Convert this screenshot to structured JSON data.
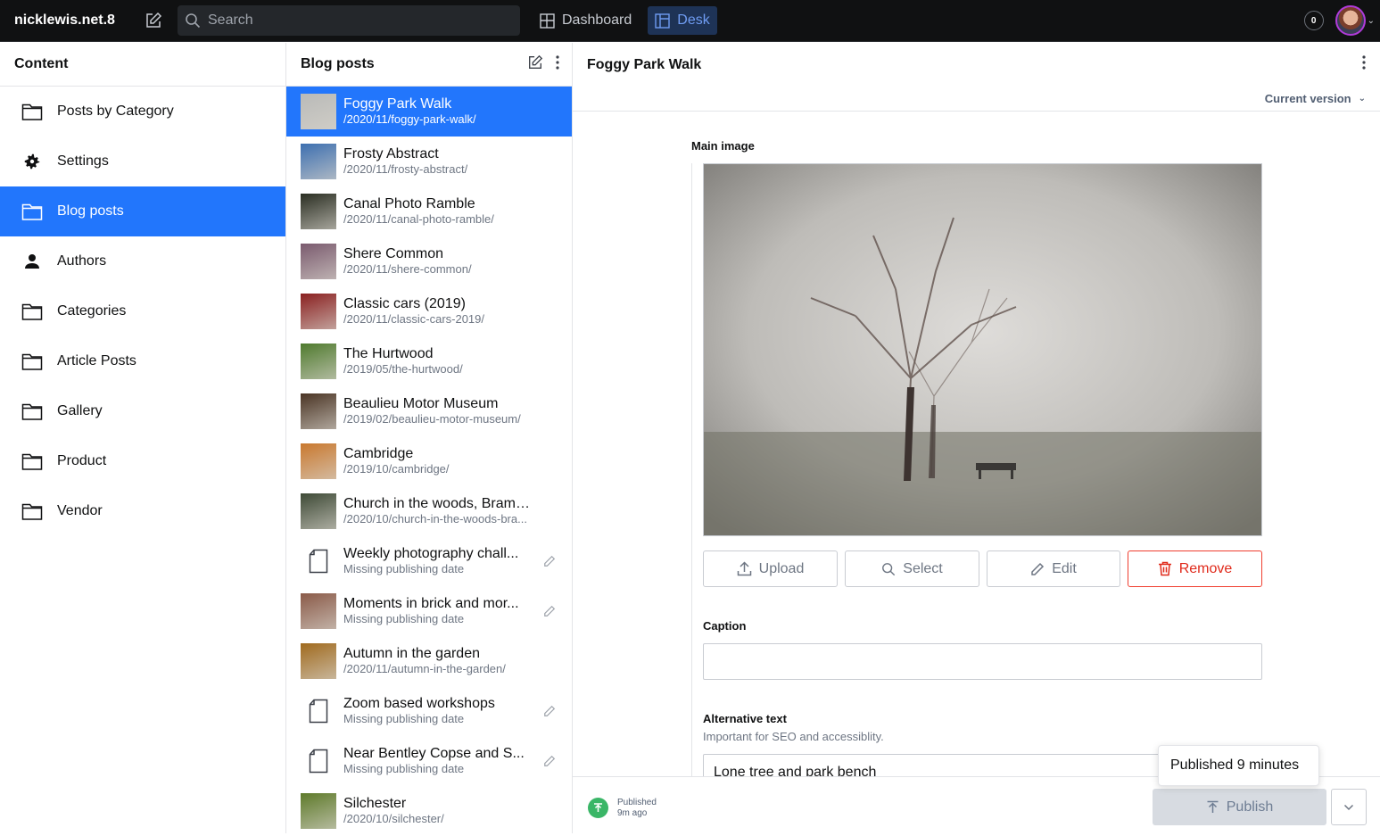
{
  "topbar": {
    "brand": "nicklewis.net.8",
    "search_placeholder": "Search",
    "tabs": [
      {
        "label": "Dashboard",
        "active": false
      },
      {
        "label": "Desk",
        "active": true
      }
    ],
    "notification_count": "0"
  },
  "content_pane": {
    "title": "Content",
    "items": [
      {
        "label": "Posts by Category",
        "icon": "folder-icon"
      },
      {
        "label": "Settings",
        "icon": "gear-icon"
      },
      {
        "label": "Blog posts",
        "icon": "folder-icon",
        "active": true
      },
      {
        "label": "Authors",
        "icon": "user-icon"
      },
      {
        "label": "Categories",
        "icon": "folder-icon"
      },
      {
        "label": "Article Posts",
        "icon": "folder-icon"
      },
      {
        "label": "Gallery",
        "icon": "folder-icon"
      },
      {
        "label": "Product",
        "icon": "folder-icon"
      },
      {
        "label": "Vendor",
        "icon": "folder-icon"
      }
    ]
  },
  "list_pane": {
    "title": "Blog posts",
    "posts": [
      {
        "title": "Foggy Park Walk",
        "subtitle": "/2020/11/foggy-park-walk/",
        "thumb": "#b9bab8",
        "active": true
      },
      {
        "title": "Frosty Abstract",
        "subtitle": "/2020/11/frosty-abstract/",
        "thumb": "#3d6fb0"
      },
      {
        "title": "Canal Photo Ramble",
        "subtitle": "/2020/11/canal-photo-ramble/",
        "thumb": "#2a2e22"
      },
      {
        "title": "Shere Common",
        "subtitle": "/2020/11/shere-common/",
        "thumb": "#7a5a6e"
      },
      {
        "title": "Classic cars (2019)",
        "subtitle": "/2020/11/classic-cars-2019/",
        "thumb": "#8a2020"
      },
      {
        "title": "The Hurtwood",
        "subtitle": "/2019/05/the-hurtwood/",
        "thumb": "#4f7a2e"
      },
      {
        "title": "Beaulieu Motor Museum",
        "subtitle": "/2019/02/beaulieu-motor-museum/",
        "thumb": "#4a3424"
      },
      {
        "title": "Cambridge",
        "subtitle": "/2019/10/cambridge/",
        "thumb": "#c9782e"
      },
      {
        "title": "Church in the woods, Bramdean",
        "subtitle": "/2020/10/church-in-the-woods-bra...",
        "thumb": "#3e4a36"
      },
      {
        "title": "Weekly photography chall...",
        "subtitle": "Missing publishing date",
        "draft": true
      },
      {
        "title": "Moments in brick and mor...",
        "subtitle": "Missing publishing date",
        "thumb": "#8a5a48",
        "draft": true
      },
      {
        "title": "Autumn in the garden",
        "subtitle": "/2020/11/autumn-in-the-garden/",
        "thumb": "#a06a1e"
      },
      {
        "title": "Zoom based workshops",
        "subtitle": "Missing publishing date",
        "draft": true
      },
      {
        "title": "Near Bentley Copse and S...",
        "subtitle": "Missing publishing date",
        "draft": true
      },
      {
        "title": "Silchester",
        "subtitle": "/2020/10/silchester/",
        "thumb": "#5e7a2a"
      }
    ]
  },
  "document": {
    "title": "Foggy Park Walk",
    "version_label": "Current version",
    "main_image_label": "Main image",
    "image_buttons": {
      "upload": "Upload",
      "select": "Select",
      "edit": "Edit",
      "remove": "Remove"
    },
    "caption_label": "Caption",
    "caption_value": "",
    "alt_label": "Alternative text",
    "alt_description": "Important for SEO and accessiblity.",
    "alt_value": "Lone tree and park bench"
  },
  "footer": {
    "status_title": "Published",
    "status_time": "9m ago",
    "publish_label": "Publish",
    "tooltip": "Published 9 minutes"
  },
  "colors": {
    "accent": "#2276fc",
    "navbar": "#101112",
    "danger": "#f03e2f",
    "published": "#3ab667"
  }
}
